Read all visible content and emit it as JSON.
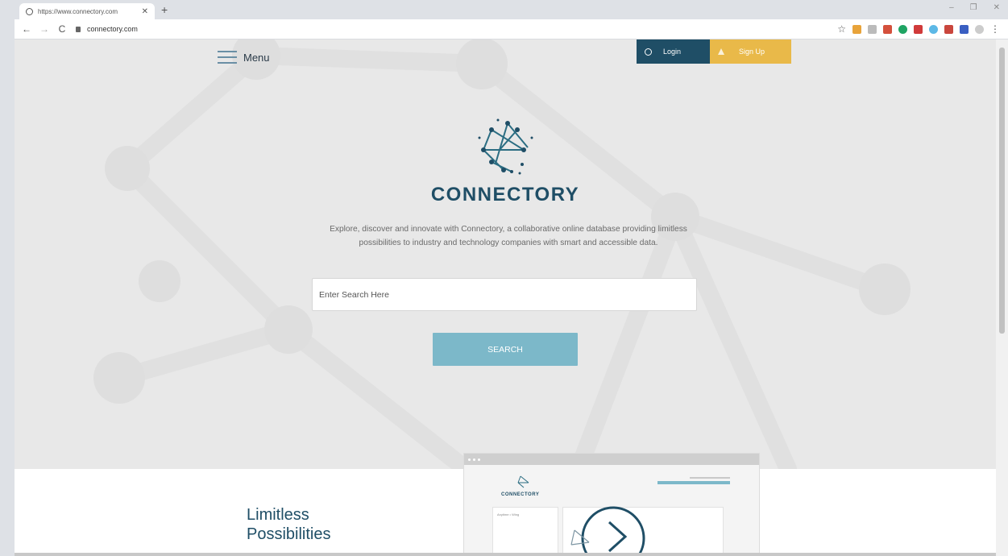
{
  "browser": {
    "tab_title": "https://www.connectory.com",
    "address": "connectory.com"
  },
  "nav": {
    "menu_label": "Menu",
    "login_label": "Login",
    "signup_label": "Sign Up"
  },
  "hero": {
    "brand": "CONNECTORY",
    "tagline": "Explore, discover and innovate with Connectory, a collaborative online database providing limitless possibilities to industry and technology companies with smart and accessible data.",
    "search_placeholder": "Enter Search Here",
    "search_button": "SEARCH"
  },
  "section": {
    "heading_line1": "Limitless",
    "heading_line2": "Possibilities"
  },
  "mockup": {
    "brand": "CONNECTORY",
    "panel_text": "Anytime • Wing"
  },
  "colors": {
    "brand": "#1f4e66",
    "accent": "#7cb8c9",
    "signup": "#e9b949"
  }
}
